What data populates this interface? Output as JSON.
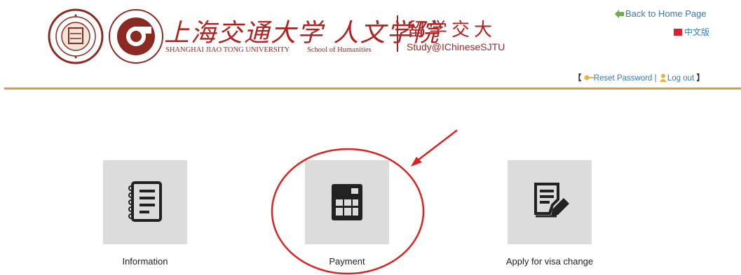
{
  "header": {
    "university_zh": "上海交通大学",
    "school_zh": "人文学院",
    "university_en": "SHANGHAI JIAO TONG UNIVERSITY",
    "school_en": "School of Humanities",
    "study_zh": "留学交大",
    "study_en": "Study@IChineseSJTU",
    "back_home": "Back to Home Page",
    "chinese_version": "中文版",
    "reset_password": "Reset Password",
    "log_out": "Log out",
    "separator": "|",
    "bracket_open": "【",
    "bracket_close": "】"
  },
  "tiles": [
    {
      "label": "Information",
      "icon": "notebook-icon"
    },
    {
      "label": "Payment",
      "icon": "calculator-icon"
    },
    {
      "label": "Apply for visa change",
      "icon": "edit-document-icon"
    }
  ],
  "colors": {
    "brand_red": "#b2201f",
    "accent_orange": "#e59a2e",
    "link_blue": "#2e7dbb",
    "tile_gray": "#dcdcdc",
    "annotation_red": "#e02020"
  }
}
